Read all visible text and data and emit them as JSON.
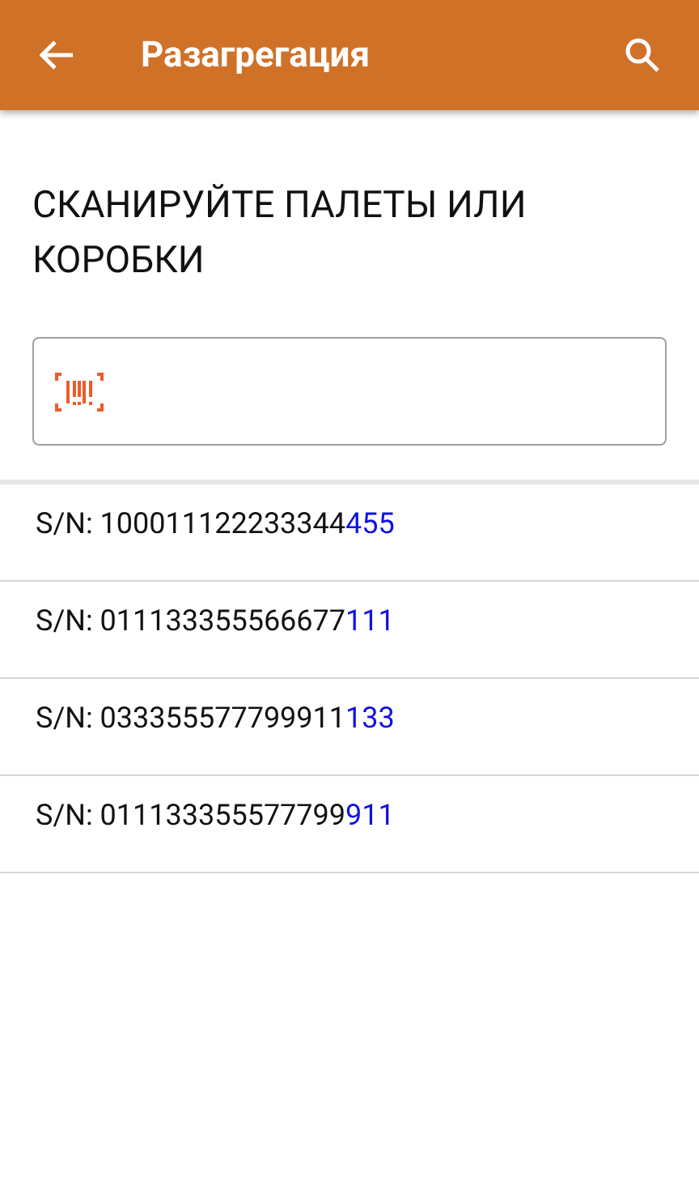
{
  "app_bar": {
    "title": "Разагрегация"
  },
  "prompt": "СКАНИРУЙТЕ ПАЛЕТЫ ИЛИ КОРОБКИ",
  "items": [
    {
      "text": "S/N: 100011122233344",
      "suffix": "455"
    },
    {
      "text": "S/N: 011133355566677",
      "suffix": "111"
    },
    {
      "text": "S/N: 033355577799911",
      "suffix": "133"
    },
    {
      "text": "S/N: 011133355577799",
      "suffix": "911"
    }
  ]
}
